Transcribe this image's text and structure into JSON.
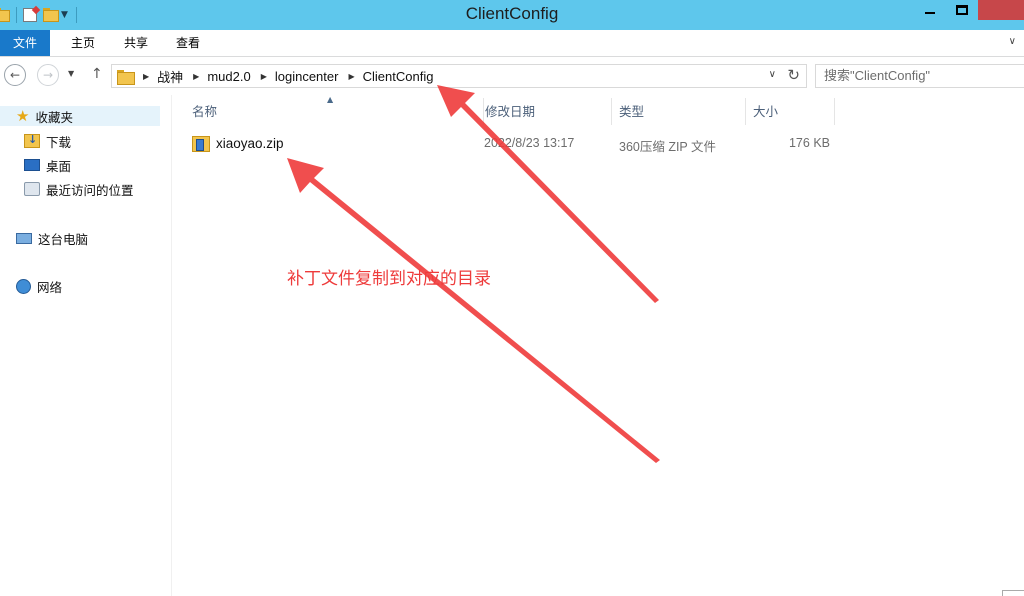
{
  "window": {
    "title": "ClientConfig",
    "quick_access": [
      "folder-icon",
      "properties-icon",
      "new-folder-icon",
      "customize-dropdown-icon"
    ],
    "controls": [
      "minimize",
      "maximize",
      "close"
    ]
  },
  "ribbon": {
    "tabs": [
      {
        "label": "文件",
        "active": true
      },
      {
        "label": "主页"
      },
      {
        "label": "共享"
      },
      {
        "label": "查看"
      }
    ]
  },
  "navbar": {
    "breadcrumbs": [
      "战神",
      "mud2.0",
      "logincenter",
      "ClientConfig"
    ],
    "search_placeholder": "搜索\"ClientConfig\""
  },
  "sidebar": {
    "favorites": {
      "label": "收藏夹"
    },
    "items": [
      {
        "label": "下载",
        "icon": "downloads-icon"
      },
      {
        "label": "桌面",
        "icon": "desktop-icon"
      },
      {
        "label": "最近访问的位置",
        "icon": "recent-places-icon"
      }
    ],
    "this_pc": {
      "label": "这台电脑"
    },
    "network": {
      "label": "网络"
    }
  },
  "file_list": {
    "columns": [
      "名称",
      "修改日期",
      "类型",
      "大小"
    ],
    "rows": [
      {
        "name": "xiaoyao.zip",
        "modified": "2022/8/23 13:17",
        "type": "360压缩 ZIP 文件",
        "size": "176 KB",
        "icon": "zip-archive-icon"
      }
    ]
  },
  "annotation": {
    "text": "补丁文件复制到对应的目录",
    "color": "#ee3b3b"
  },
  "colors": {
    "titlebar": "#5ec7ec",
    "file_tab": "#1979ca",
    "close_button": "#c7474a",
    "selection": "#e5f3fb"
  }
}
